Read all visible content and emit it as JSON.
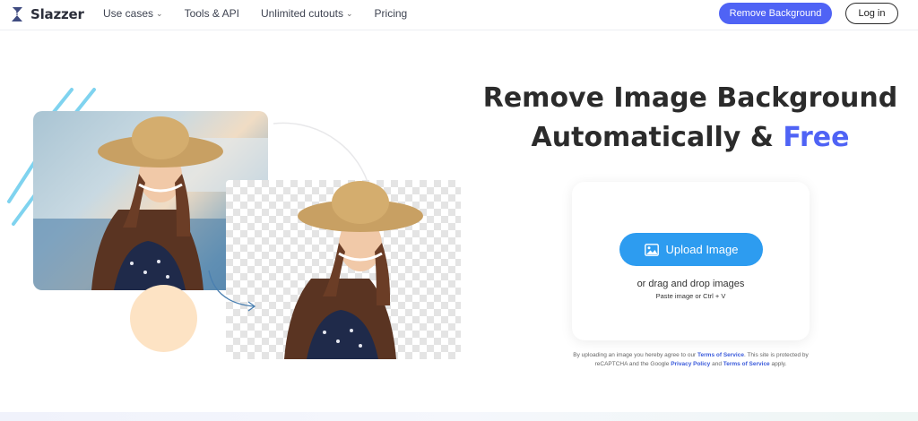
{
  "header": {
    "logo_text": "Slazzer",
    "nav": [
      {
        "label": "Use cases",
        "has_dropdown": true
      },
      {
        "label": "Tools & API",
        "has_dropdown": false
      },
      {
        "label": "Unlimited cutouts",
        "has_dropdown": true
      },
      {
        "label": "Pricing",
        "has_dropdown": false
      }
    ],
    "remove_bg_label": "Remove Background",
    "login_label": "Log in"
  },
  "hero": {
    "headline_line1": "Remove Image Background",
    "headline_line2_prefix": "Automatically &",
    "headline_highlight": "Free"
  },
  "upload": {
    "button_label": "Upload Image",
    "drag_text": "or drag and drop images",
    "paste_text": "Paste image or Ctrl + V"
  },
  "terms": {
    "text1": "By uploading an image you hereby agree to our",
    "link1": "Terms of Service",
    "text2": ". This site is protected by reCAPTCHA and the Google",
    "link2": "Privacy Policy",
    "text3": "and",
    "link3": "Terms of Service",
    "text4": "apply."
  },
  "colors": {
    "accent": "#4f63f5",
    "upload_button": "#2d9cf0",
    "peach": "#fde3c4",
    "deco_lines": "#7fd3ef"
  },
  "icons": {
    "logo": "slazzer-logo-icon",
    "upload": "image-icon",
    "dropdown": "chevron-down-icon"
  }
}
